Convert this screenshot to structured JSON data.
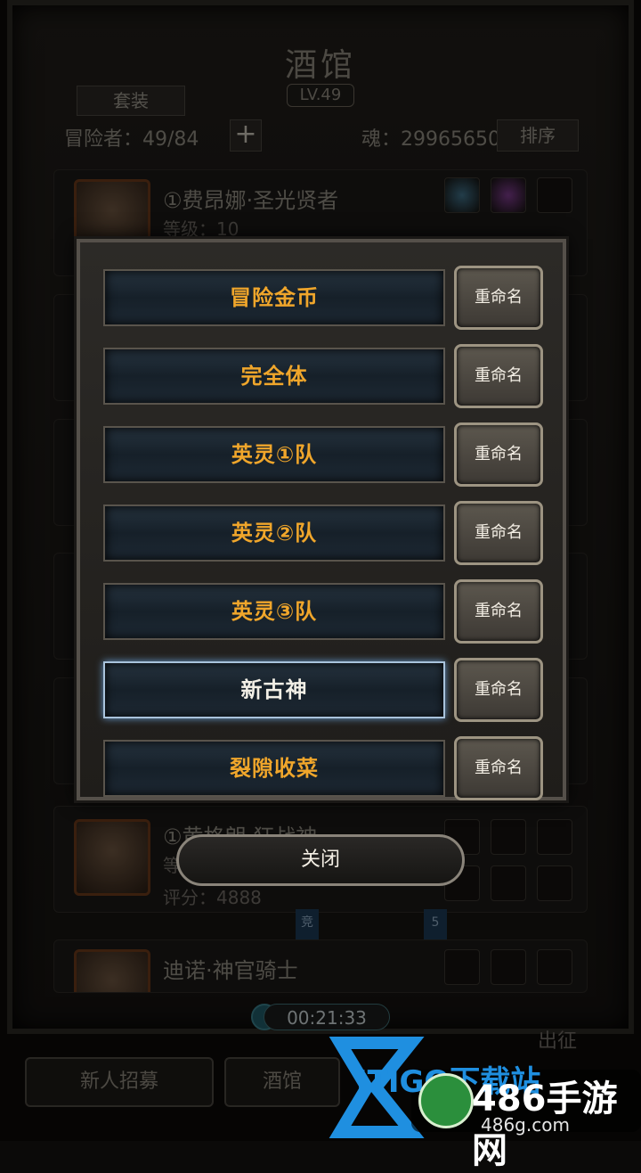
{
  "header": {
    "title": "酒馆",
    "level": "LV.49",
    "suit_button": "套装",
    "adventurers": "冒险者：49/84",
    "plus": "+",
    "soul": "魂：29965650",
    "sort_button": "排序"
  },
  "background_heroes": [
    {
      "name": "①费昂娜·圣光贤者",
      "level": "等级：10"
    },
    {
      "name": "①黄格朗·狂战神",
      "level": "等",
      "score": "评分：4888"
    },
    {
      "name": "迪诺·神官骑士"
    }
  ],
  "badges": [
    "竞",
    "5"
  ],
  "dialog": {
    "rows": [
      {
        "label": "冒险金币",
        "rename": "重命名",
        "selected": false
      },
      {
        "label": "完全体",
        "rename": "重命名",
        "selected": false
      },
      {
        "label": "英灵①队",
        "rename": "重命名",
        "selected": false
      },
      {
        "label": "英灵②队",
        "rename": "重命名",
        "selected": false
      },
      {
        "label": "英灵③队",
        "rename": "重命名",
        "selected": false
      },
      {
        "label": "新古神",
        "rename": "重命名",
        "selected": true
      },
      {
        "label": "裂隙收菜",
        "rename": "重命名",
        "selected": false
      }
    ],
    "close": "关闭"
  },
  "timer": "00:21:33",
  "bottom": {
    "recruit": "新人招募",
    "tavern": "酒馆",
    "exit": "出征"
  },
  "watermark": {
    "brand_partial": "ITIGO下载站",
    "site": "486手游网",
    "domain": "486g.com"
  }
}
